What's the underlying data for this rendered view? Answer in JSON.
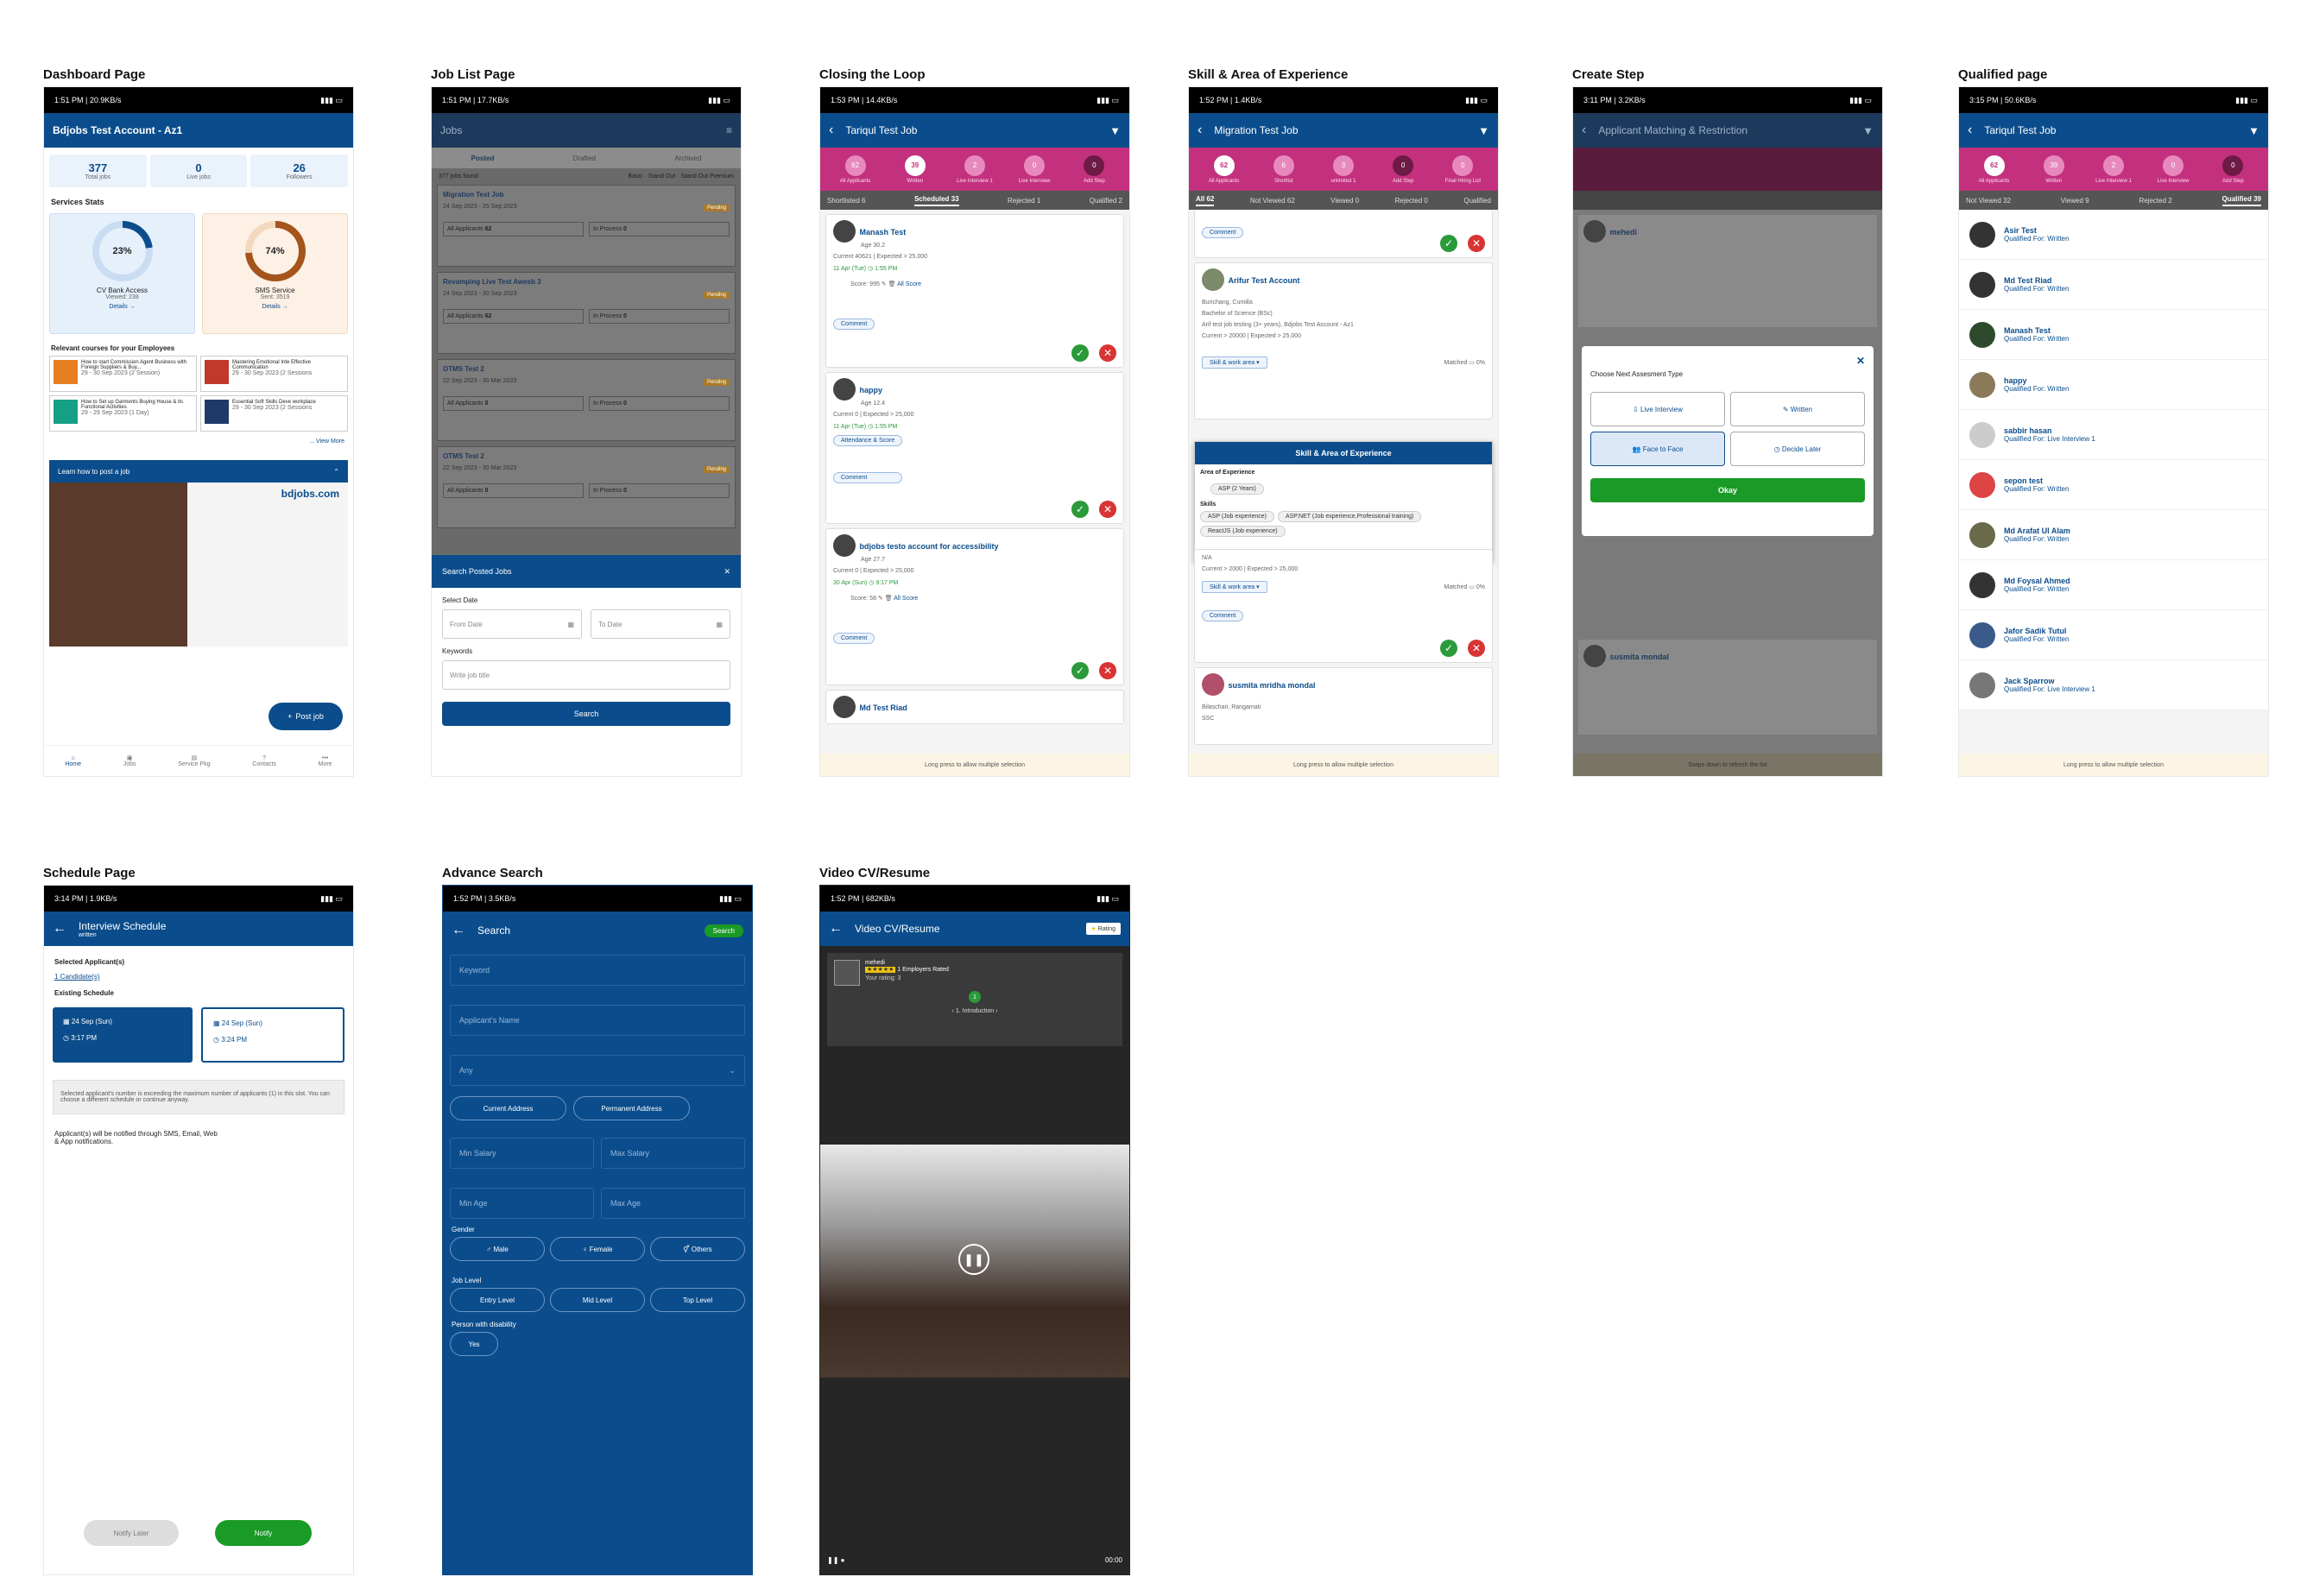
{
  "sections": [
    "Dashboard Page",
    "Job List Page",
    "Closing the Loop",
    "Skill & Area of Experience",
    "Create Step",
    "Qualified page",
    "Schedule Page",
    "Advance Search",
    "Video CV/Resume"
  ],
  "dash": {
    "status_time": "1:51 PM | 20.9KB/s",
    "account": "Bdjobs Test Account - Az1",
    "stats": [
      {
        "v": "377",
        "l": "Total jobs"
      },
      {
        "v": "0",
        "l": "Live jobs"
      },
      {
        "v": "26",
        "l": "Followers"
      }
    ],
    "services_title": "Services Stats",
    "cv_pct": "23%",
    "cv_name": "CV Bank Access",
    "cv_viewed": "Viewed: 238",
    "sms_pct": "74%",
    "sms_name": "SMS Service",
    "sms_sent": "Sent: 3519",
    "details": "Details",
    "courses_title": "Relevant courses for your Employees",
    "courses": [
      {
        "t": "How to start Commission Agent Business with Foreign Suppliers & Buy...",
        "d": "29 - 30 Sep 2023 (2 Session)"
      },
      {
        "t": "Mastering Emotional Inte Effective Communication",
        "d": "29 - 30 Sep 2023 (2 Sessions"
      },
      {
        "t": "How to Set up Garments Buying House & its Functional Activities",
        "d": "29 - 29 Sep 2023 (1 Day)"
      },
      {
        "t": "Essential Soft Skills Deve workplace",
        "d": "29 - 30 Sep 2023 (2 Sessions"
      }
    ],
    "view_more": "View More",
    "learn": "Learn how to post a job",
    "brand": "bdjobs.com",
    "post_job": "Post job",
    "nav": [
      "Home",
      "Jobs",
      "Service Pkg",
      "Contacts",
      "More"
    ]
  },
  "joblist": {
    "status_time": "1:51 PM | 17.7KB/s",
    "title": "Jobs",
    "tabs": [
      "Posted",
      "Drafted",
      "Archived"
    ],
    "found": "377 jobs found",
    "badges": [
      "Basic",
      "Stand Out",
      "Stand Out Premium"
    ],
    "jobs": [
      {
        "t": "Migration Test Job",
        "d": "24 Sep 2023 - 25 Sep 2023",
        "a": "All Applicants",
        "n": "62",
        "p": "In Process",
        "pn": "0"
      },
      {
        "t": "Revamping Live Test Awesb 3",
        "d": "24 Sep 2023 - 30 Sep 2023",
        "a": "All Applicants",
        "n": "62",
        "p": "In Process",
        "pn": "0"
      },
      {
        "t": "OTMS Test 2",
        "d": "22 Sep 2023 - 30 Mar 2023",
        "a": "All Applicants",
        "n": "0",
        "p": "In Process",
        "pn": "0"
      },
      {
        "t": "OTMS Test 2",
        "d": "22 Sep 2023 - 30 Mar 2023",
        "a": "All Applicants",
        "n": "0",
        "p": "In Process",
        "pn": "0"
      }
    ],
    "pending": "Pending",
    "search_title": "Search Posted Jobs",
    "select_date": "Select Date",
    "from": "From Date",
    "to": "To Date",
    "keywords": "Keywords",
    "kw_ph": "Write job title",
    "search": "Search"
  },
  "loop": {
    "status_time": "1:53 PM | 14.4KB/s",
    "title": "Tariqul Test Job",
    "steps": [
      {
        "n": "62",
        "l": "All Applicants"
      },
      {
        "n": "39",
        "l": "Written"
      },
      {
        "n": "2",
        "l": "Live Interview 1"
      },
      {
        "n": "0",
        "l": "Live Interview"
      },
      {
        "n": "0",
        "l": "Add Step"
      }
    ],
    "tabs": [
      "Shortlisted 6",
      "Scheduled 33",
      "Rejected 1",
      "Qualified 2"
    ],
    "cards": [
      {
        "n": "Manash Test",
        "a": "Age 30.2",
        "c": "Current 40621 | Expected > 25,000",
        "dt": "11 Apr (Tue)",
        "tm": "1:55 PM",
        "sc": "Score: 995",
        "all": "All Score"
      },
      {
        "n": "happy",
        "a": "Age 12.4",
        "c": "Current 0 | Expected > 25,000",
        "dt": "11 Apr (Tue)",
        "tm": "1:55 PM",
        "sc": "Attendance & Score",
        "all": ""
      },
      {
        "n": "bdjobs testo account for accessibility",
        "a": "Age 27.7",
        "c": "Current 0 | Expected > 25,000",
        "dt": "30 Apr (Sun)",
        "tm": "9:17 PM",
        "sc": "Score: 58",
        "all": "All Score"
      }
    ],
    "last": "Md Test Riad",
    "comment": "Comment",
    "hint": "Long press to allow multiple selection"
  },
  "skill": {
    "status_time": "1:52 PM | 1.4KB/s",
    "title": "Migration Test Job",
    "steps": [
      {
        "n": "62",
        "l": "All Applicants"
      },
      {
        "n": "6",
        "l": "Shortlist"
      },
      {
        "n": "3",
        "l": "unlimited 1"
      },
      {
        "n": "0",
        "l": "Add Step"
      },
      {
        "n": "0",
        "l": "Final Hiring List"
      }
    ],
    "tabs": [
      "All 62",
      "Not Viewed 62",
      "Viewed 0",
      "Rejected 0",
      "Qualified"
    ],
    "p1": "Arifur Test Account",
    "p1info": [
      "Burichang, Cumilla",
      "Bachelor of Science (BSc)",
      "Arif test job testing (3+ years), Bdjobs Test Account - Az1",
      "Current > 20000 | Expected > 25,000"
    ],
    "popup_title": "Skill & Area of Experience",
    "area": "Area of Experience",
    "area_items": [
      "ASP (2 Years)"
    ],
    "skills": "Skills",
    "skill_items": [
      "ASP (Job experience)",
      "ASP.NET (Job experience,Professional training)",
      "ReactJS (Job experience)"
    ],
    "sw": "Skill & work area",
    "matched": "Matched",
    "pct": "0%",
    "na": "N/A",
    "cur2": "Current > 2000 | Expected > 25,000",
    "p2": "susmita mridha mondal",
    "p2loc": "Bilaschari, Rangamati",
    "ssc": "SSC",
    "comment": "Comment",
    "hint": "Long press to allow multiple selection"
  },
  "create": {
    "status_time": "3:11 PM | 3.2KB/s",
    "title": "Applicant Matching & Restriction",
    "modal_title": "Choose Next Assesment Type",
    "opts": [
      "Live Interview",
      "Written",
      "Face to Face",
      "Decide Later"
    ],
    "okay": "Okay",
    "bg_name": "mehedi",
    "bg_name2": "susmita mondal",
    "hint": "Swipe down to refresh the list"
  },
  "qual": {
    "status_time": "3:15 PM | 50.6KB/s",
    "title": "Tariqul Test Job",
    "steps": [
      {
        "n": "62",
        "l": "All Applicants"
      },
      {
        "n": "39",
        "l": "Written"
      },
      {
        "n": "2",
        "l": "Live Interview 1"
      },
      {
        "n": "0",
        "l": "Live Interview"
      },
      {
        "n": "0",
        "l": "Add Step"
      }
    ],
    "tabs": [
      "Not Viewed 32",
      "Viewed 9",
      "Rejected 2",
      "Qualified 39"
    ],
    "list": [
      {
        "n": "Asir Test",
        "q": "Qualified For: Written"
      },
      {
        "n": "Md Test Riad",
        "q": "Qualified For: Written"
      },
      {
        "n": "Manash Test",
        "q": "Qualified For: Written"
      },
      {
        "n": "happy",
        "q": "Qualified For: Written"
      },
      {
        "n": "sabbir hasan",
        "q": "Qualified For: Live Interview 1"
      },
      {
        "n": "sepon test",
        "q": "Qualified For: Written"
      },
      {
        "n": "Md Arafat Ul Alam",
        "q": "Qualified For: Written"
      },
      {
        "n": "Md Foysal Ahmed",
        "q": "Qualified For: Written"
      },
      {
        "n": "Jafor Sadik Tutul",
        "q": "Qualified For: Written"
      },
      {
        "n": "Jack Sparrow",
        "q": "Qualified For: Live Interview 1"
      }
    ],
    "hint": "Long press to allow multiple selection"
  },
  "sched": {
    "status_time": "3:14 PM | 1.9KB/s",
    "title": "Interview Schedule",
    "sub": "written",
    "sel": "Selected Applicant(s)",
    "cand": "1 Candidate(s)",
    "exist": "Existing Schedule",
    "s1d": "24 Sep (Sun)",
    "s1t": "3:17 PM",
    "s2d": "24 Sep (Sun)",
    "s2t": "3:24 PM",
    "warn": "Selected applicant's number is exceeding the maximum number of applicants (1) in this slot. You can choose a different schedule or continue anyway.",
    "note": "Applicant(s) will be notified through SMS, Email, Web & App notifications.",
    "later": "Notify Later",
    "notify": "Notify"
  },
  "adv": {
    "status_time": "1:52 PM | 3.5KB/s",
    "title": "Search",
    "search_btn": "Search",
    "keyword": "Keyword",
    "appname": "Applicant's Name",
    "any": "Any",
    "cur": "Current Address",
    "perm": "Permanent Address",
    "minsal": "Min Salary",
    "maxsal": "Max Salary",
    "minage": "Min Age",
    "maxage": "Max Age",
    "gender": "Gender",
    "male": "Male",
    "female": "Female",
    "others": "Others",
    "joblevel": "Job Level",
    "entry": "Entry Level",
    "mid": "Mid Level",
    "top": "Top Level",
    "dis": "Person with disability",
    "yes": "Yes"
  },
  "video": {
    "status_time": "1:52 PM | 682KB/s",
    "title": "Video CV/Resume",
    "rating_btn": "Rating",
    "name": "mehedi",
    "rated": "1 Employers Rated",
    "your": "Your rating: 3",
    "q": "1",
    "intro": "1. Introduction",
    "time": "00:00"
  }
}
